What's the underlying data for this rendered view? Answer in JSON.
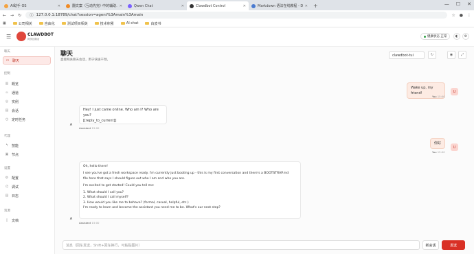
{
  "browser": {
    "tabs": [
      {
        "title": "AI助手 OS",
        "color": "#f4a340"
      },
      {
        "title": "翻文案（互动先完）·中的辅助…",
        "color": "#f08a24"
      },
      {
        "title": "Qwen Chat",
        "color": "#7b61ff"
      },
      {
        "title": "Clawdbot Control",
        "color": "#333333"
      },
      {
        "title": "Markdown 语法在线教程 - D…",
        "color": "#4a7bd0"
      }
    ],
    "url": "127.0.0.1:18789/chat?session=agent%3Amain%3Amain",
    "bookmarks": [
      "公司相关",
      "自由化",
      "测试项目相关",
      "技术积累",
      "AI-chat",
      "白皮书"
    ]
  },
  "app": {
    "brand": "CLAWDBOT",
    "brand_sub": "网关控制台",
    "health_label": "健康状态 正常",
    "sidebar": {
      "sections": [
        {
          "title": "聊天",
          "items": [
            {
              "label": "聊天",
              "icon": "chat-icon",
              "active": true
            }
          ]
        },
        {
          "title": "控制",
          "items": [
            {
              "label": "概览",
              "icon": "chart-icon"
            },
            {
              "label": "通道",
              "icon": "link-icon"
            },
            {
              "label": "实例",
              "icon": "radio-icon"
            },
            {
              "label": "会话",
              "icon": "doc-icon"
            },
            {
              "label": "定时任务",
              "icon": "clock-icon"
            }
          ]
        },
        {
          "title": "代理",
          "items": [
            {
              "label": "技能",
              "icon": "bolt-icon"
            },
            {
              "label": "节点",
              "icon": "node-icon"
            }
          ]
        },
        {
          "title": "设置",
          "items": [
            {
              "label": "配置",
              "icon": "gear-icon"
            },
            {
              "label": "调试",
              "icon": "bug-icon"
            },
            {
              "label": "日志",
              "icon": "log-icon"
            }
          ]
        },
        {
          "title": "资源",
          "items": [
            {
              "label": "文档",
              "icon": "book-icon"
            }
          ]
        }
      ]
    },
    "page": {
      "title": "聊天",
      "subtitle": "直接网关聊天会话，用于快速干预。",
      "session": "clawdbot-tui"
    },
    "messages": [
      {
        "role": "user",
        "avatar": "U",
        "text": "Wake up, my friend!",
        "meta": "You",
        "time": "15:00"
      },
      {
        "role": "assistant",
        "avatar": "A",
        "lines": [
          "Hey! I just came online. Who am I? Who are you?",
          "",
          "[[reply_to_current]]"
        ],
        "meta": "Assistant",
        "time": "15:00"
      },
      {
        "role": "user",
        "avatar": "U",
        "text": "你好",
        "meta": "You",
        "time": "15:00"
      },
      {
        "role": "assistant",
        "avatar": "A",
        "lines": [
          "Oh, hello there!",
          "",
          "I see you've got a fresh workspace ready. I'm currently just booting up - this is my first conversation and there's a BOOTSTRAP.md",
          "file here that says I should figure out who I am and who you are.",
          "",
          "I'm excited to get started! Could you tell me:",
          "",
          "1. What should I call you?",
          "2. What should I call myself?",
          "3. How would you like me to behave? (formal, casual, helpful, etc.)",
          "I'm ready to learn and become the assistant you need me to be. What's our next step?"
        ],
        "meta": "Assistant",
        "time": "15:00"
      }
    ],
    "composer": {
      "placeholder": "消息（回车发送，Shift+回车换行，可粘贴图片）",
      "new_session": "新会话",
      "send": "发送"
    }
  }
}
